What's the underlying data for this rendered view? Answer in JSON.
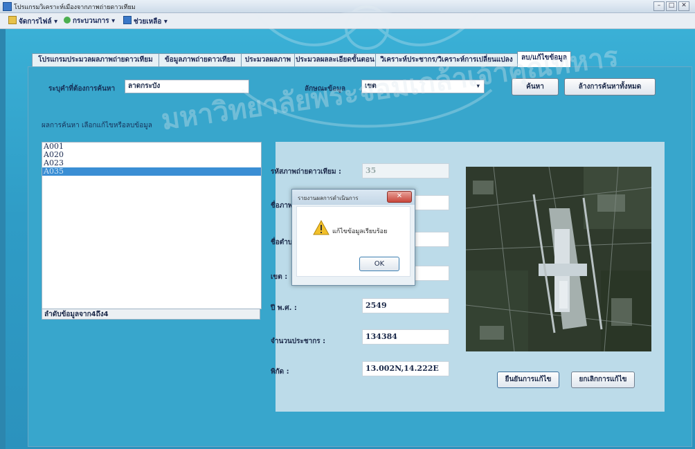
{
  "window": {
    "title": "โปรแกรมวิเคราะห์เมืองจากภาพถ่ายดาวเทียม",
    "controls": {
      "minimize": "–",
      "maximize": "□",
      "close": "✕"
    }
  },
  "menu": [
    {
      "label": "จัดการไฟล์",
      "icon": "folder-icon"
    },
    {
      "label": "กระบวนการ",
      "icon": "process-icon"
    },
    {
      "label": "ช่วยเหลือ",
      "icon": "help-icon"
    }
  ],
  "tabs": [
    {
      "label": "โปรแกรมประมวลผลภาพถ่ายดาวเทียม",
      "active": false
    },
    {
      "label": "ข้อมูลภาพถ่ายดาวเทียม",
      "active": false
    },
    {
      "label": "ประมวลผลภาพ",
      "active": false
    },
    {
      "label": "ประมวลผลละเอียดขั้นตอน",
      "active": false
    },
    {
      "label": "วิเคราะห์ประชากร/วิเคราะห์การเปลี่ยนแปลง",
      "active": false
    },
    {
      "label": "ลบ/แก้ไขข้อมูล",
      "active": true
    }
  ],
  "search": {
    "label": "ระบุคำที่ต้องการค้นหา",
    "value": "ลาดกระบัง",
    "category_label": "ลักษณะข้อมูล",
    "category_value": "เขต",
    "search_button": "ค้นหา",
    "clear_button": "ล้างการค้นหาทั้งหมด"
  },
  "results": {
    "heading": "ผลการค้นหา เลือกแก้ไขหรือลบข้อมูล",
    "items": [
      "A001",
      "A020",
      "A023",
      "A035"
    ],
    "selected_index": 3,
    "status": "ลำดับข้อมูลจาก4ถึง4"
  },
  "detail": {
    "fields": [
      {
        "label": "รหัสภาพถ่ายดาวเทียม :",
        "value": "35",
        "disabled": true
      },
      {
        "label": "ชื่อภาพ",
        "value": "",
        "disabled": false
      },
      {
        "label": "ชื่อตำบล",
        "value": "",
        "disabled": false
      },
      {
        "label": "เขต :",
        "value": "",
        "disabled": false
      },
      {
        "label": "ปี พ.ศ. :",
        "value": "2549",
        "disabled": false
      },
      {
        "label": "จำนวนประชากร :",
        "value": "134384",
        "disabled": false
      },
      {
        "label": "พิกัด :",
        "value": "13.002N,14.222E",
        "disabled": false
      }
    ],
    "save_button": "ยืนยันการแก้ไข",
    "cancel_button": "ยกเลิกการแก้ไข"
  },
  "dialog": {
    "title": "รายงานผลการดำเนินการ",
    "message": "แก้ไขข้อมูลเรียบร้อย",
    "ok_button": "OK",
    "close_glyph": "✕"
  },
  "watermark": "มหาวิทยาลัยพระจอมเกล้าเจ้าคุณทหาร"
}
